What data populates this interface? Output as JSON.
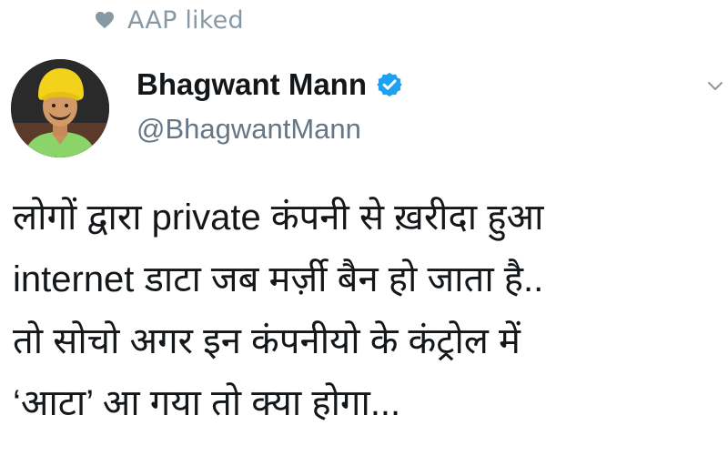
{
  "social_context": {
    "text": "AAP liked",
    "icon": "heart-icon",
    "color": "#8899a6"
  },
  "author": {
    "display_name": "Bhagwant Mann",
    "handle": "@BhagwantMann",
    "verified": true,
    "verified_color": "#1da1f2"
  },
  "menu": {
    "icon": "chevron-down-icon"
  },
  "tweet": {
    "lines": [
      "लोगों द्वारा private कंपनी से ख़रीदा हुआ",
      "internet डाटा जब मर्ज़ी बैन हो जाता है..",
      "तो सोचो अगर इन कंपनीयो के कंट्रोल में",
      "‘आटा’ आ गया तो क्या होगा..."
    ]
  }
}
